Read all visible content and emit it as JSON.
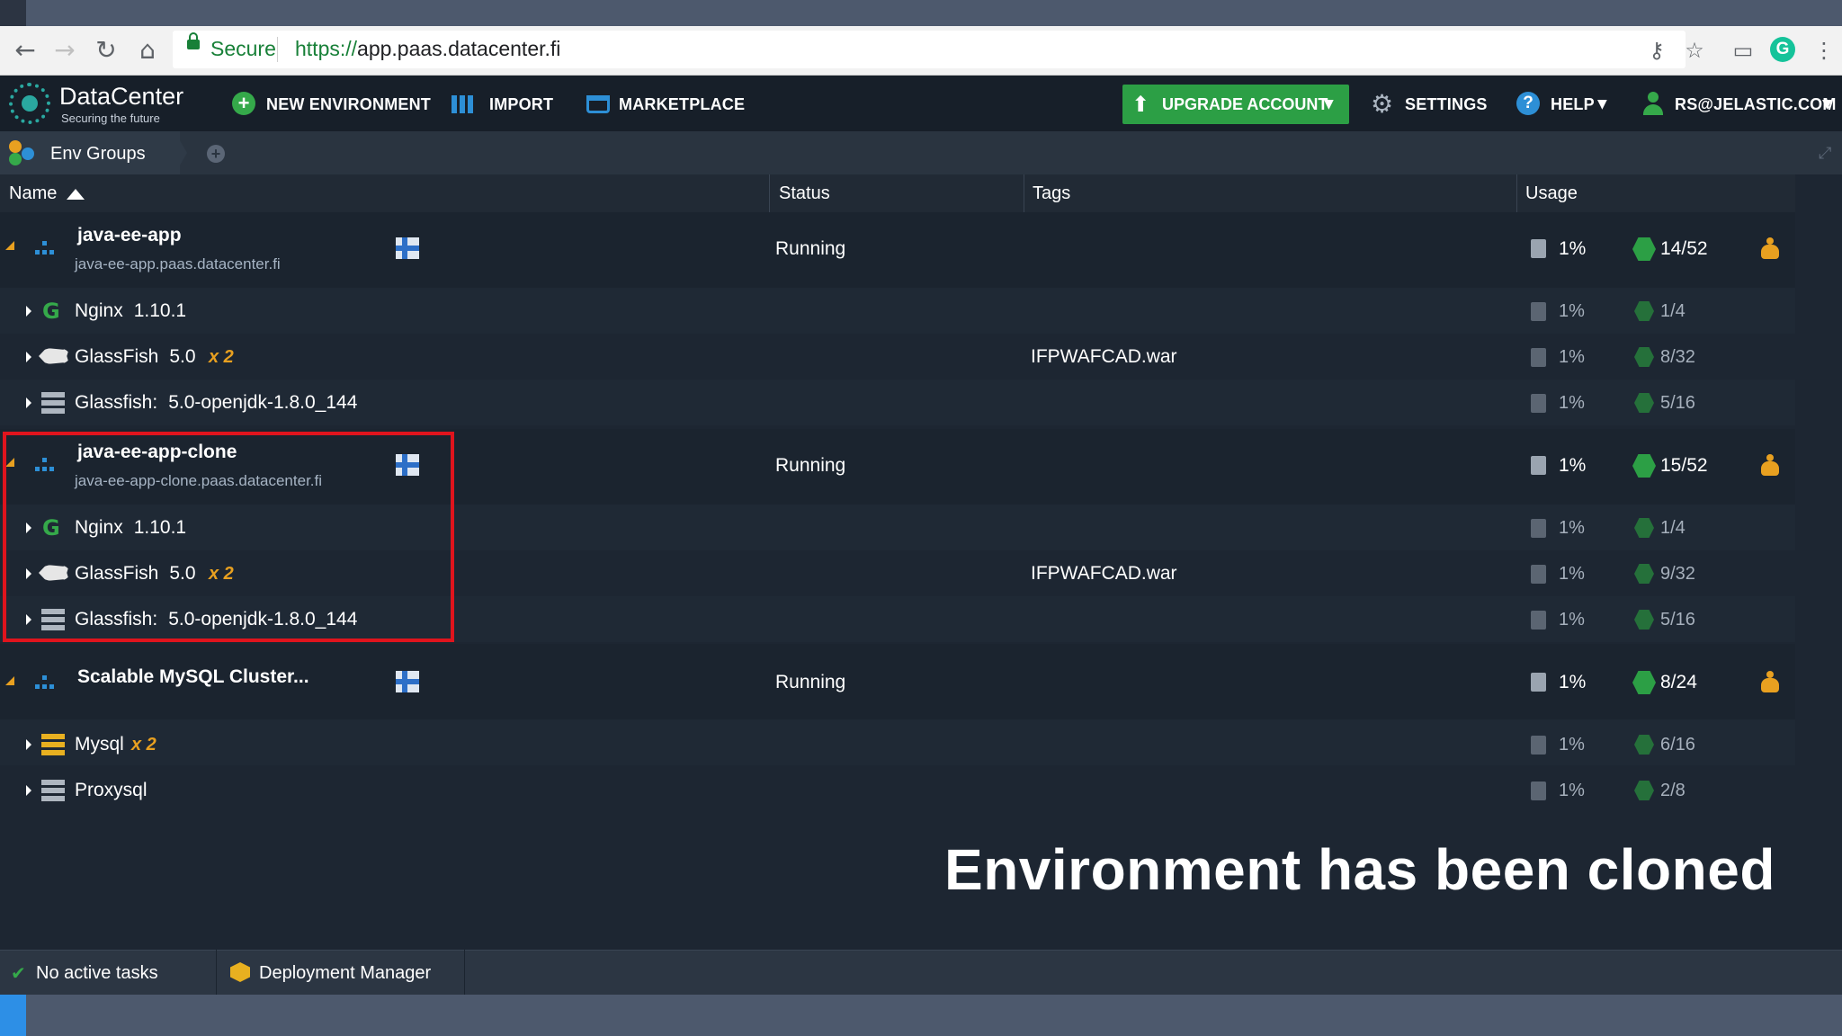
{
  "browser": {
    "secure_label": "Secure",
    "url_protocol": "https://",
    "url_host": "app.paas.datacenter.fi",
    "extension_letter": "G"
  },
  "header": {
    "logo_name": "DataCenter",
    "logo_tagline": "Securing the future",
    "new_environment": "NEW ENVIRONMENT",
    "import": "IMPORT",
    "marketplace": "MARKETPLACE",
    "upgrade_account": "UPGRADE ACCOUNT",
    "settings": "SETTINGS",
    "help": "HELP",
    "user": "RS@JELASTIC.COM"
  },
  "tabs": {
    "env_groups": "Env Groups"
  },
  "grid": {
    "columns": {
      "name": "Name",
      "status": "Status",
      "tags": "Tags",
      "usage": "Usage"
    },
    "environments": [
      {
        "name": "java-ee-app",
        "domain": "java-ee-app.paas.datacenter.fi",
        "status": "Running",
        "disk": "1%",
        "cloudlets": "14/52",
        "nodes": [
          {
            "name": "Nginx",
            "version": "1.10.1",
            "count": "",
            "tag": "",
            "disk": "1%",
            "cloudlets": "1/4",
            "icon": "nginx-icon"
          },
          {
            "name": "GlassFish",
            "version": "5.0",
            "count": "x 2",
            "tag": "IFPWAFCAD.war",
            "disk": "1%",
            "cloudlets": "8/32",
            "icon": "glassfish-icon"
          },
          {
            "name": "Glassfish:",
            "version": "5.0-openjdk-1.8.0_144",
            "count": "",
            "tag": "",
            "disk": "1%",
            "cloudlets": "5/16",
            "icon": "server-icon"
          }
        ]
      },
      {
        "name": "java-ee-app-clone",
        "domain": "java-ee-app-clone.paas.datacenter.fi",
        "status": "Running",
        "disk": "1%",
        "cloudlets": "15/52",
        "nodes": [
          {
            "name": "Nginx",
            "version": "1.10.1",
            "count": "",
            "tag": "",
            "disk": "1%",
            "cloudlets": "1/4",
            "icon": "nginx-icon"
          },
          {
            "name": "GlassFish",
            "version": "5.0",
            "count": "x 2",
            "tag": "IFPWAFCAD.war",
            "disk": "1%",
            "cloudlets": "9/32",
            "icon": "glassfish-icon"
          },
          {
            "name": "Glassfish:",
            "version": "5.0-openjdk-1.8.0_144",
            "count": "",
            "tag": "",
            "disk": "1%",
            "cloudlets": "5/16",
            "icon": "server-icon"
          }
        ]
      },
      {
        "name": "Scalable MySQL Cluster...",
        "domain": "",
        "status": "Running",
        "disk": "1%",
        "cloudlets": "8/24",
        "nodes": [
          {
            "name": "Mysql",
            "version": "",
            "count": "x 2",
            "tag": "",
            "disk": "1%",
            "cloudlets": "6/16",
            "icon": "mysql-icon"
          },
          {
            "name": "Proxysql",
            "version": "",
            "count": "",
            "tag": "",
            "disk": "1%",
            "cloudlets": "2/8",
            "icon": "server-icon"
          }
        ]
      }
    ]
  },
  "caption": "Environment has been cloned",
  "statusbar": {
    "tasks": "No active tasks",
    "deployment_manager": "Deployment Manager"
  },
  "colors": {
    "accent_green": "#2c9f45",
    "highlight_red": "#e0141d",
    "background": "#1d2632"
  }
}
